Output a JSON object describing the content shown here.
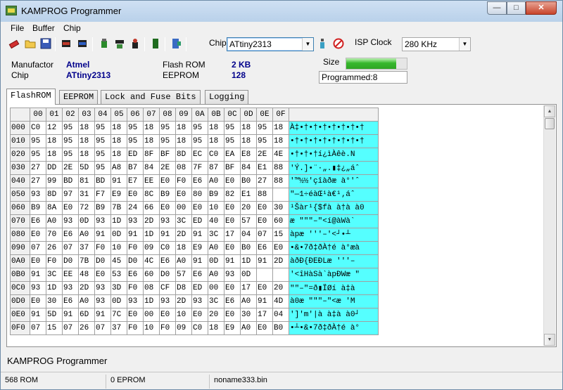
{
  "window": {
    "title": "KAMPROG Programmer",
    "min_glyph": "—",
    "max_glyph": "□",
    "close_glyph": "✕"
  },
  "menu": [
    {
      "label": "File"
    },
    {
      "label": "Buffer"
    },
    {
      "label": "Chip"
    }
  ],
  "toolbar": {
    "icons": [
      "eraser-icon",
      "open-folder-icon",
      "save-disk-icon",
      "chip-read-icon",
      "chip-write-icon",
      "chip-verify-icon",
      "chip-blank-icon",
      "chip-erase-icon",
      "chip-program-icon",
      "exit-icon"
    ],
    "chip_label": "Chip",
    "chip_value": "ATtiny2313",
    "isp_label": "ISP Clock",
    "isp_value": "280 KHz"
  },
  "info": {
    "manufactor_label": "Manufactor",
    "manufactor_value": "Atmel",
    "chip_label": "Chip",
    "chip_value": "ATtiny2313",
    "flash_label": "Flash ROM",
    "flash_value": "2 KB",
    "eeprom_label": "EEPROM",
    "eeprom_value": "128",
    "size_label": "Size",
    "size_fraction": 0.82,
    "programmed_text": "Programmed:8"
  },
  "tabs": [
    {
      "label": "FlashROM",
      "active": true
    },
    {
      "label": "EEPROM",
      "active": false
    },
    {
      "label": "Lock and Fuse Bits",
      "active": false
    },
    {
      "label": "Logging",
      "active": false
    }
  ],
  "hex": {
    "columns": [
      "00",
      "01",
      "02",
      "03",
      "04",
      "05",
      "06",
      "07",
      "08",
      "09",
      "0A",
      "0B",
      "0C",
      "0D",
      "0E",
      "0F"
    ],
    "rows": [
      {
        "addr": "000",
        "bytes": [
          "C0",
          "12",
          "95",
          "18",
          "95",
          "18",
          "95",
          "18",
          "95",
          "18",
          "95",
          "18",
          "95",
          "18",
          "95",
          "18"
        ],
        "ascii": "À‡•†•†•†•†•†•†•†"
      },
      {
        "addr": "010",
        "bytes": [
          "95",
          "18",
          "95",
          "18",
          "95",
          "18",
          "95",
          "18",
          "95",
          "18",
          "95",
          "18",
          "95",
          "18",
          "95",
          "18"
        ],
        "ascii": "•†•†•†•†•†•†•†•†"
      },
      {
        "addr": "020",
        "bytes": [
          "95",
          "18",
          "95",
          "18",
          "95",
          "18",
          "ED",
          "8F",
          "BF",
          "8D",
          "EC",
          "C0",
          "EA",
          "E8",
          "2E",
          "4E"
        ],
        "ascii": "•†•†•†í¿ìÀêè.N"
      },
      {
        "addr": "030",
        "bytes": [
          "27",
          "DD",
          "2E",
          "5D",
          "95",
          "A8",
          "B7",
          "84",
          "2E",
          "08",
          "7F",
          "87",
          "BF",
          "84",
          "E1",
          "88"
        ],
        "ascii": "'Ý.]•¨·„.▮‡¿„áˆ"
      },
      {
        "addr": "040",
        "bytes": [
          "27",
          "99",
          "BD",
          "81",
          "BD",
          "91",
          "E7",
          "EE",
          "E0",
          "F0",
          "E6",
          "A0",
          "E0",
          "B0",
          "27",
          "88"
        ],
        "ascii": "'™½½'çîàðæ à°'ˆ"
      },
      {
        "addr": "050",
        "bytes": [
          "93",
          "8D",
          "97",
          "31",
          "F7",
          "E9",
          "E0",
          "8C",
          "B9",
          "E0",
          "80",
          "B9",
          "82",
          "E1",
          "88"
        ],
        "ascii": "\"—1÷éàŒ¹à€¹‚áˆ"
      },
      {
        "addr": "060",
        "bytes": [
          "B9",
          "8A",
          "E0",
          "72",
          "B9",
          "7B",
          "24",
          "66",
          "E0",
          "00",
          "E0",
          "10",
          "E0",
          "20",
          "E0",
          "30"
        ],
        "ascii": "¹Šàr¹{$fà à†à à0"
      },
      {
        "addr": "070",
        "bytes": [
          "E6",
          "A0",
          "93",
          "0D",
          "93",
          "1D",
          "93",
          "2D",
          "93",
          "3C",
          "ED",
          "40",
          "E0",
          "57",
          "E0",
          "60"
        ],
        "ascii": "æ \"\"\"–\"<í@àWà`"
      },
      {
        "addr": "080",
        "bytes": [
          "E0",
          "70",
          "E6",
          "A0",
          "91",
          "0D",
          "91",
          "1D",
          "91",
          "2D",
          "91",
          "3C",
          "17",
          "04",
          "07",
          "15"
        ],
        "ascii": "àpæ '''–'<┘•┴"
      },
      {
        "addr": "090",
        "bytes": [
          "07",
          "26",
          "07",
          "37",
          "F0",
          "10",
          "F0",
          "09",
          "C0",
          "18",
          "E9",
          "A0",
          "E0",
          "B0",
          "E6",
          "E0"
        ],
        "ascii": "•&•7ð‡ðÀ†é à°æà"
      },
      {
        "addr": "0A0",
        "bytes": [
          "E0",
          "F0",
          "D0",
          "7B",
          "D0",
          "45",
          "D0",
          "4C",
          "E6",
          "A0",
          "91",
          "0D",
          "91",
          "1D",
          "91",
          "2D"
        ],
        "ascii": "àðÐ{ÐEÐLæ '''–"
      },
      {
        "addr": "0B0",
        "bytes": [
          "91",
          "3C",
          "EE",
          "48",
          "E0",
          "53",
          "E6",
          "60",
          "D0",
          "57",
          "E6",
          "A0",
          "93",
          "0D"
        ],
        "ascii": "'<îHàSà`àpÐWæ \""
      },
      {
        "addr": "0C0",
        "bytes": [
          "93",
          "1D",
          "93",
          "2D",
          "93",
          "3D",
          "F0",
          "08",
          "CF",
          "D8",
          "ED",
          "00",
          "E0",
          "17",
          "E0",
          "20"
        ],
        "ascii": "\"\"–\"=ð▮ÏØí à‡à"
      },
      {
        "addr": "0D0",
        "bytes": [
          "E0",
          "30",
          "E6",
          "A0",
          "93",
          "0D",
          "93",
          "1D",
          "93",
          "2D",
          "93",
          "3C",
          "E6",
          "A0",
          "91",
          "4D"
        ],
        "ascii": "à0æ \"\"\"–\"<æ 'M"
      },
      {
        "addr": "0E0",
        "bytes": [
          "91",
          "5D",
          "91",
          "6D",
          "91",
          "7C",
          "E0",
          "00",
          "E0",
          "10",
          "E0",
          "20",
          "E0",
          "30",
          "17",
          "04"
        ],
        "ascii": "']'m'|à à‡à à0┘"
      },
      {
        "addr": "0F0",
        "bytes": [
          "07",
          "15",
          "07",
          "26",
          "07",
          "37",
          "F0",
          "10",
          "F0",
          "09",
          "C0",
          "18",
          "E9",
          "A0",
          "E0",
          "B0"
        ],
        "ascii": "•┴•&•7ð‡ðÀ†é à°"
      }
    ]
  },
  "status": {
    "title": "KAMPROG Programmer",
    "rom": "568 ROM",
    "eprom": "0 EPROM",
    "file": "noname333.bin"
  }
}
